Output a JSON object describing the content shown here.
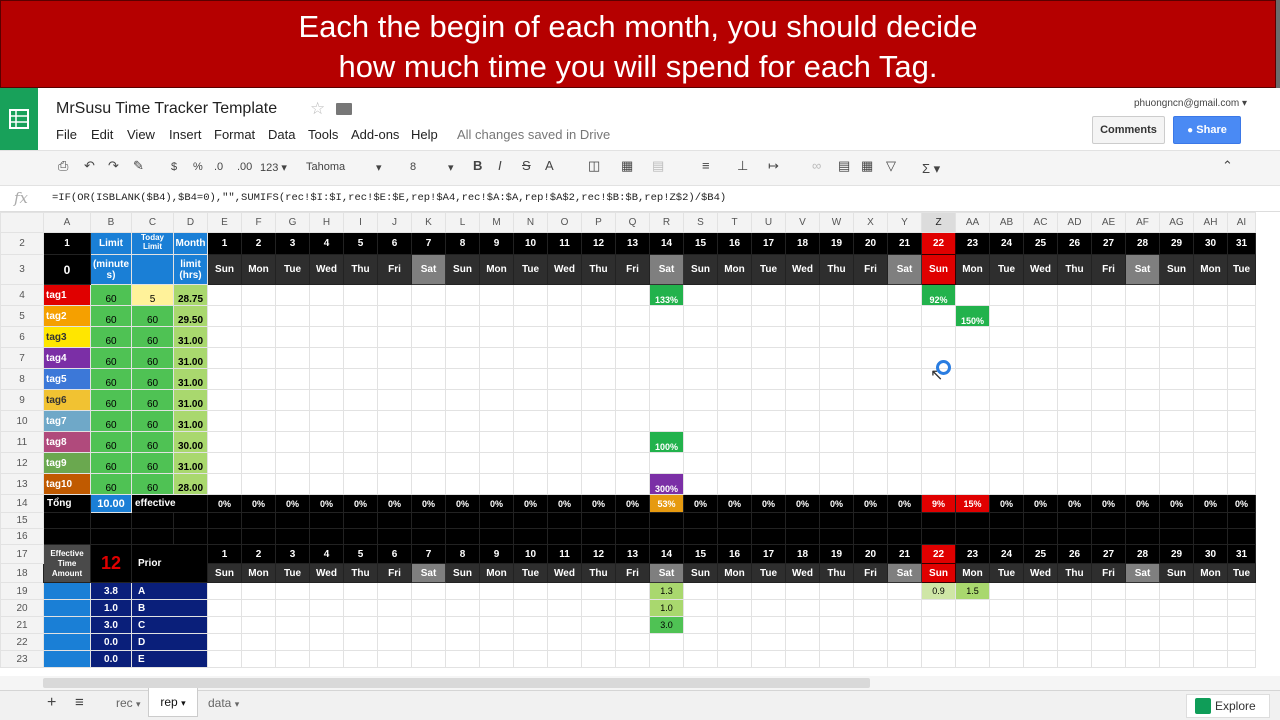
{
  "banner": {
    "line1": "Each the begin of each month, you should decide",
    "line2": "how much time you will spend for each Tag."
  },
  "app": {
    "title": "MrSusu Time Tracker Template",
    "saved_status": "All changes saved in Drive",
    "account": "phuongncn@gmail.com ▾",
    "comments": "Comments",
    "share": "Share"
  },
  "menu": [
    "File",
    "Edit",
    "View",
    "Insert",
    "Format",
    "Data",
    "Tools",
    "Add-ons",
    "Help"
  ],
  "toolbar": {
    "currency": "$",
    "percent": "%",
    "dec_less": ".0",
    "dec_more": ".00",
    "format_more": "123 ▾",
    "font": "Tahoma",
    "font_size": "8",
    "bold": "B",
    "italic": "I",
    "strike": "S",
    "textcolor": "A",
    "function": "Σ ▾"
  },
  "formula": "=IF(OR(ISBLANK($B4),$B4=0),\"\",SUMIFS(rec!$I:$I,rec!$E:$E,rep!$A4,rec!$A:$A,rep!$A$2,rec!$B:$B,rep!Z$2)/$B4)",
  "columns": [
    "A",
    "B",
    "C",
    "D",
    "E",
    "F",
    "G",
    "H",
    "I",
    "J",
    "K",
    "L",
    "M",
    "N",
    "O",
    "P",
    "Q",
    "R",
    "S",
    "T",
    "U",
    "V",
    "W",
    "X",
    "Y",
    "Z",
    "AA",
    "AB",
    "AC",
    "AD",
    "AE",
    "AF",
    "AG",
    "AH",
    "AI"
  ],
  "rownums": [
    "2",
    "3",
    "4",
    "5",
    "6",
    "7",
    "8",
    "9",
    "10",
    "11",
    "12",
    "13",
    "14",
    "15",
    "16",
    "17",
    "18",
    "19",
    "20",
    "21",
    "22",
    "23"
  ],
  "header": {
    "a2": "1",
    "a3": "0",
    "limit": "Limit",
    "minutes": "(minute s)",
    "today_limit": "Today Limit",
    "month": "Month",
    "month_limit": "limit (hrs)"
  },
  "days": [
    "1",
    "2",
    "3",
    "4",
    "5",
    "6",
    "7",
    "8",
    "9",
    "10",
    "11",
    "12",
    "13",
    "14",
    "15",
    "16",
    "17",
    "18",
    "19",
    "20",
    "21",
    "22",
    "23",
    "24",
    "25",
    "26",
    "27",
    "28",
    "29",
    "30",
    "31"
  ],
  "weekdays": [
    "Sun",
    "Mon",
    "Tue",
    "Wed",
    "Thu",
    "Fri",
    "Sat",
    "Sun",
    "Mon",
    "Tue",
    "Wed",
    "Thu",
    "Fri",
    "Sat",
    "Sun",
    "Mon",
    "Tue",
    "Wed",
    "Thu",
    "Fri",
    "Sat",
    "Sun",
    "Mon",
    "Tue",
    "Wed",
    "Thu",
    "Fri",
    "Sat",
    "Sun",
    "Mon",
    "Tue"
  ],
  "tags": [
    {
      "name": "tag1",
      "color": "#e00000",
      "limit": "60",
      "today": "5",
      "month": "28.75"
    },
    {
      "name": "tag2",
      "color": "#f5a000",
      "limit": "60",
      "today": "60",
      "month": "29.50"
    },
    {
      "name": "tag3",
      "color": "#ffe600",
      "limit": "60",
      "today": "60",
      "month": "31.00"
    },
    {
      "name": "tag4",
      "color": "#7b2fa6",
      "limit": "60",
      "today": "60",
      "month": "31.00"
    },
    {
      "name": "tag5",
      "color": "#3c78d8",
      "limit": "60",
      "today": "60",
      "month": "31.00"
    },
    {
      "name": "tag6",
      "color": "#f1c232",
      "limit": "60",
      "today": "60",
      "month": "31.00"
    },
    {
      "name": "tag7",
      "color": "#6fa8c8",
      "limit": "60",
      "today": "60",
      "month": "31.00"
    },
    {
      "name": "tag8",
      "color": "#b04a7c",
      "limit": "60",
      "today": "60",
      "month": "30.00"
    },
    {
      "name": "tag9",
      "color": "#6aa84f",
      "limit": "60",
      "today": "60",
      "month": "31.00"
    },
    {
      "name": "tag10",
      "color": "#c05a00",
      "limit": "60",
      "today": "60",
      "month": "28.00"
    }
  ],
  "tag_pcts": [
    {
      "row": 0,
      "day": 14,
      "value": "133%",
      "color": "#22b24c"
    },
    {
      "row": 0,
      "day": 22,
      "value": "92%",
      "color": "#22b24c"
    },
    {
      "row": 1,
      "day": 23,
      "value": "150%",
      "color": "#22b24c"
    },
    {
      "row": 7,
      "day": 14,
      "value": "100%",
      "color": "#22b24c"
    },
    {
      "row": 9,
      "day": 14,
      "value": "300%",
      "color": "#7b2fa6"
    }
  ],
  "row14": {
    "label": "Tổng",
    "total": "10.00",
    "effective": "effective",
    "values": [
      "0%",
      "0%",
      "0%",
      "0%",
      "0%",
      "0%",
      "0%",
      "0%",
      "0%",
      "0%",
      "0%",
      "0%",
      "0%",
      "53%",
      "0%",
      "0%",
      "0%",
      "0%",
      "0%",
      "0%",
      "0%",
      "9%",
      "15%",
      "0%",
      "0%",
      "0%",
      "0%",
      "0%",
      "0%",
      "0%",
      "0%"
    ]
  },
  "row17": {
    "label": "Effective Time Amount",
    "big": "12",
    "prior": "Prior"
  },
  "priors": [
    {
      "amount": "3.8",
      "letter": "A"
    },
    {
      "amount": "1.0",
      "letter": "B"
    },
    {
      "amount": "3.0",
      "letter": "C"
    },
    {
      "amount": "0.0",
      "letter": "D"
    },
    {
      "amount": "0.0",
      "letter": "E"
    }
  ],
  "prior_values": [
    {
      "row": 0,
      "day": 14,
      "value": "1.3"
    },
    {
      "row": 1,
      "day": 14,
      "value": "1.0"
    },
    {
      "row": 2,
      "day": 14,
      "value": "3.0"
    },
    {
      "row": 0,
      "day": 22,
      "value": "0.9"
    },
    {
      "row": 0,
      "day": 23,
      "value": "1.5"
    }
  ],
  "highlight_days": {
    "sat_sun_gray": [
      7,
      14,
      21,
      28
    ],
    "today": 22
  },
  "sheets": {
    "add": "+",
    "list": "≡",
    "tabs": [
      "rec",
      "rep",
      "data"
    ],
    "explore": "Explore"
  }
}
